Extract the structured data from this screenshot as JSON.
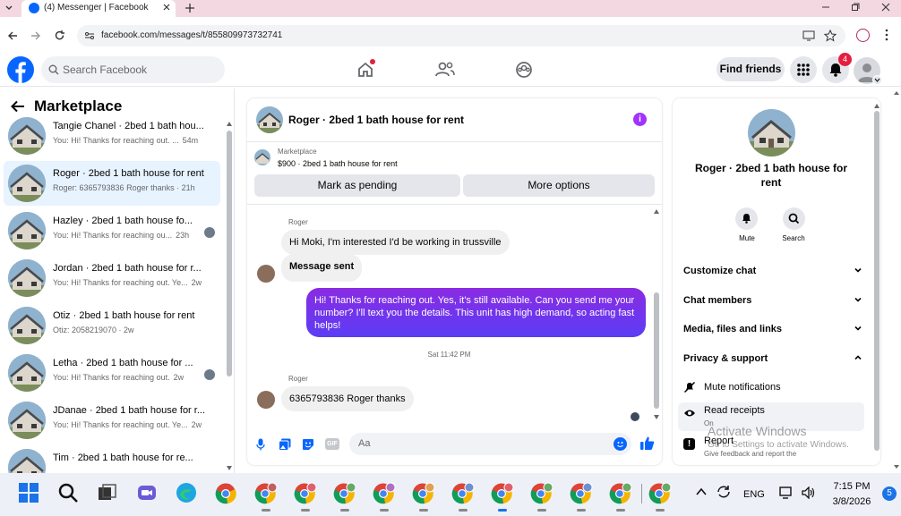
{
  "browser": {
    "tab_title": "(4) Messenger | Facebook",
    "url": "facebook.com/messages/t/855809973732741"
  },
  "fb_header": {
    "search_placeholder": "Search Facebook",
    "find_friends": "Find friends",
    "notification_count": "4"
  },
  "left_panel": {
    "title": "Marketplace",
    "conversations": [
      {
        "name": "Tangie Chanel · 2bed 1 bath hou...",
        "snippet": "You: Hi! Thanks for reaching out. ...",
        "time": "54m",
        "selected": false
      },
      {
        "name": "Roger · 2bed 1 bath house for rent",
        "snippet": "Roger: 6365793836 Roger thanks · 21h",
        "time": "",
        "selected": true
      },
      {
        "name": "Hazley · 2bed 1 bath house fo...",
        "snippet": "You: Hi! Thanks for reaching ou...",
        "time": "23h",
        "selected": false
      },
      {
        "name": "Jordan · 2bed 1 bath house for r...",
        "snippet": "You: Hi! Thanks for reaching out. Ye...",
        "time": "2w",
        "selected": false
      },
      {
        "name": "Otiz · 2bed 1 bath house for rent",
        "snippet": "Otiz: 2058219070 · 2w",
        "time": "",
        "selected": false
      },
      {
        "name": "Letha · 2bed 1 bath house for ...",
        "snippet": "You: Hi! Thanks for reaching out.",
        "time": "2w",
        "selected": false
      },
      {
        "name": "JDanae · 2bed 1 bath house for r...",
        "snippet": "You: Hi! Thanks for reaching out. Ye...",
        "time": "2w",
        "selected": false
      },
      {
        "name": "Tim · 2bed 1 bath house for re...",
        "snippet": "",
        "time": "",
        "selected": false
      }
    ]
  },
  "chat": {
    "title": "Roger · 2bed 1 bath house for rent",
    "listing_label": "Marketplace",
    "listing_text": "$900 · 2bed 1 bath house for rent",
    "mark_pending": "Mark as pending",
    "more_options": "More options",
    "sender1": "Roger",
    "msg1": "Hi Moki, I'm interested I'd be working in trussville",
    "msg2": "Message sent",
    "msg3": "Hi! Thanks for reaching out. Yes, it's still available. Can you send me your number? I'll text you the details. This unit has high demand, so acting fast helps!",
    "timestamp": "Sat 11:42 PM",
    "sender2": "Roger",
    "msg4": "6365793836 Roger thanks",
    "composer_placeholder": "Aa",
    "gif_label": "GIF"
  },
  "details": {
    "title": "Roger · 2bed 1 bath house for rent",
    "mute_label": "Mute",
    "search_label": "Search",
    "sections": {
      "customize": "Customize chat",
      "members": "Chat members",
      "media": "Media, files and links",
      "privacy": "Privacy & support"
    },
    "mute_notifications": "Mute notifications",
    "read_receipts": "Read receipts",
    "read_receipts_state": "On",
    "report": "Report",
    "report_sub": "Give feedback and report the",
    "watermark_title": "Activate Windows",
    "watermark_sub": "Go to Settings to activate Windows."
  },
  "taskbar": {
    "lang": "ENG",
    "time": "7:15 PM",
    "date": "3/8/2026",
    "notif_count": "5"
  },
  "colors": {
    "accent_blue": "#0866ff",
    "messenger_purple": "#7b2ff2",
    "badge_red": "#e41e3f"
  }
}
